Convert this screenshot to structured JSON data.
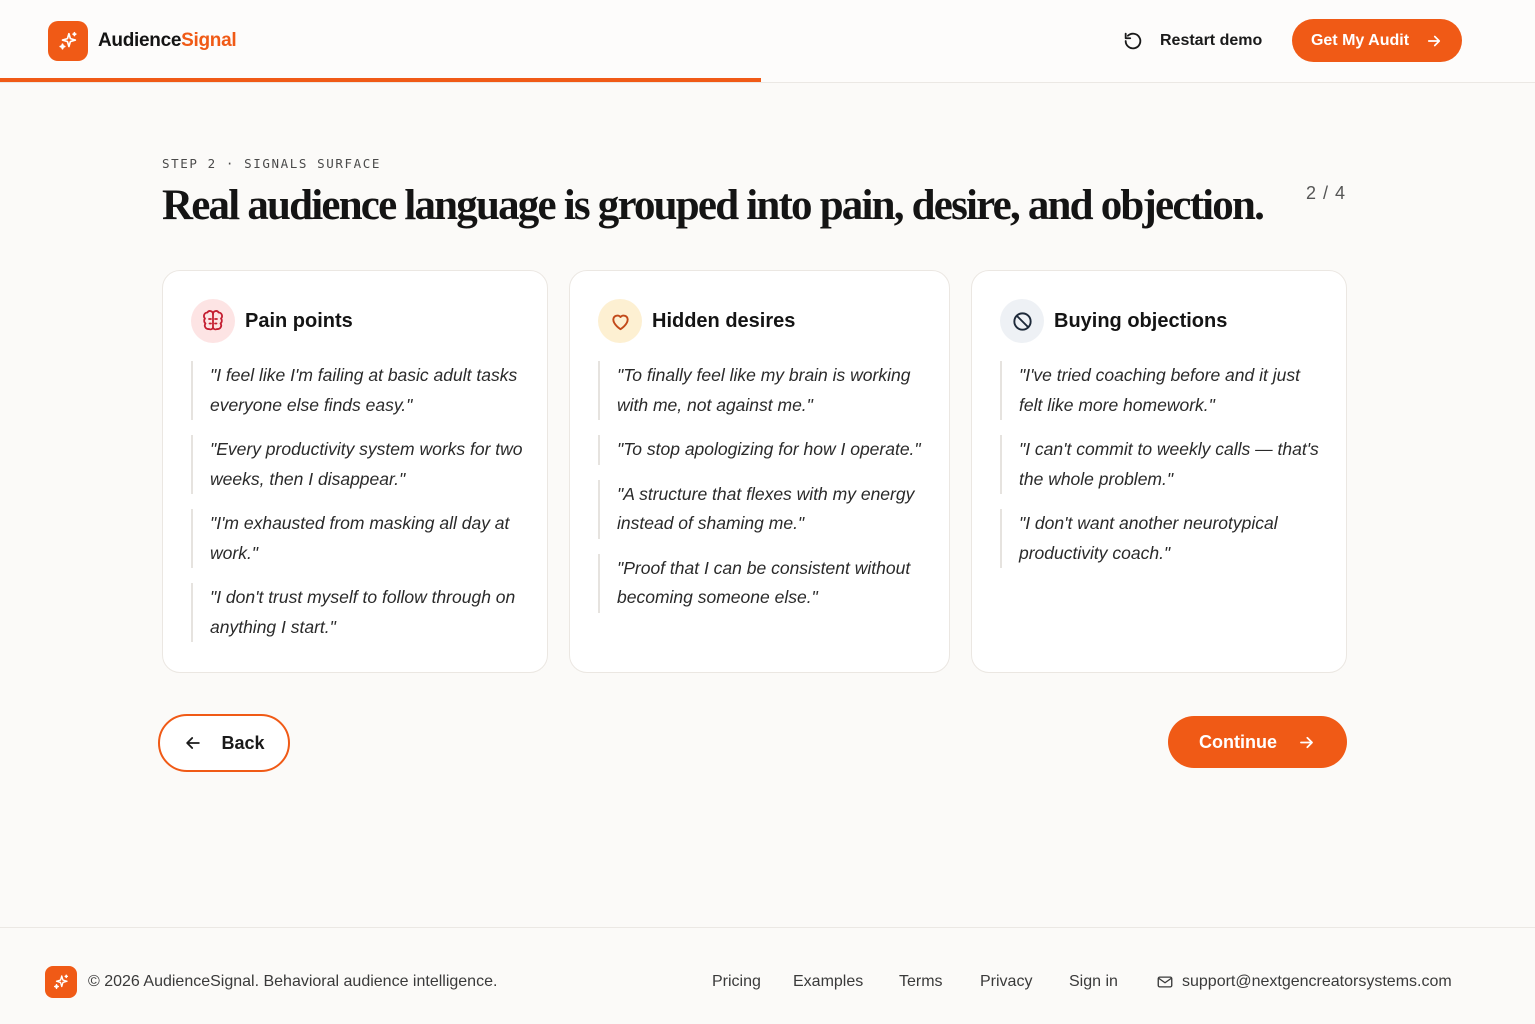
{
  "header": {
    "brand_part1": "Audience",
    "brand_part2": "Signal",
    "restart_label": "Restart demo",
    "audit_label": "Get My Audit",
    "progress_percent": 49.6,
    "accent_color": "#f05a16"
  },
  "main": {
    "step_label": "STEP 2 · SIGNALS SURFACE",
    "title": "Real audience language is grouped into pain, desire, and objection.",
    "pager": "2 / 4"
  },
  "cards": [
    {
      "title": "Pain points",
      "icon": "brain-icon",
      "quotes": [
        "\"I feel like I'm failing at basic adult tasks everyone else finds easy.\"",
        "\"Every productivity system works for two weeks, then I disappear.\"",
        "\"I'm exhausted from masking all day at work.\"",
        "\"I don't trust myself to follow through on anything I start.\""
      ]
    },
    {
      "title": "Hidden desires",
      "icon": "heart-icon",
      "quotes": [
        "\"To finally feel like my brain is working with me, not against me.\"",
        "\"To stop apologizing for how I operate.\"",
        "\"A structure that flexes with my energy instead of shaming me.\"",
        "\"Proof that I can be consistent without becoming someone else.\""
      ]
    },
    {
      "title": "Buying objections",
      "icon": "ban-icon",
      "quotes": [
        "\"I've tried coaching before and it just felt like more homework.\"",
        "\"I can't commit to weekly calls — that's the whole problem.\"",
        "\"I don't want another neurotypical productivity coach.\""
      ]
    }
  ],
  "nav": {
    "back_label": "Back",
    "continue_label": "Continue"
  },
  "footer": {
    "copyright": "© 2026 AudienceSignal. Behavioral audience intelligence.",
    "links": [
      "Pricing",
      "Examples",
      "Terms",
      "Privacy",
      "Sign in"
    ],
    "support_email": "support@nextgencreatorsystems.com"
  }
}
